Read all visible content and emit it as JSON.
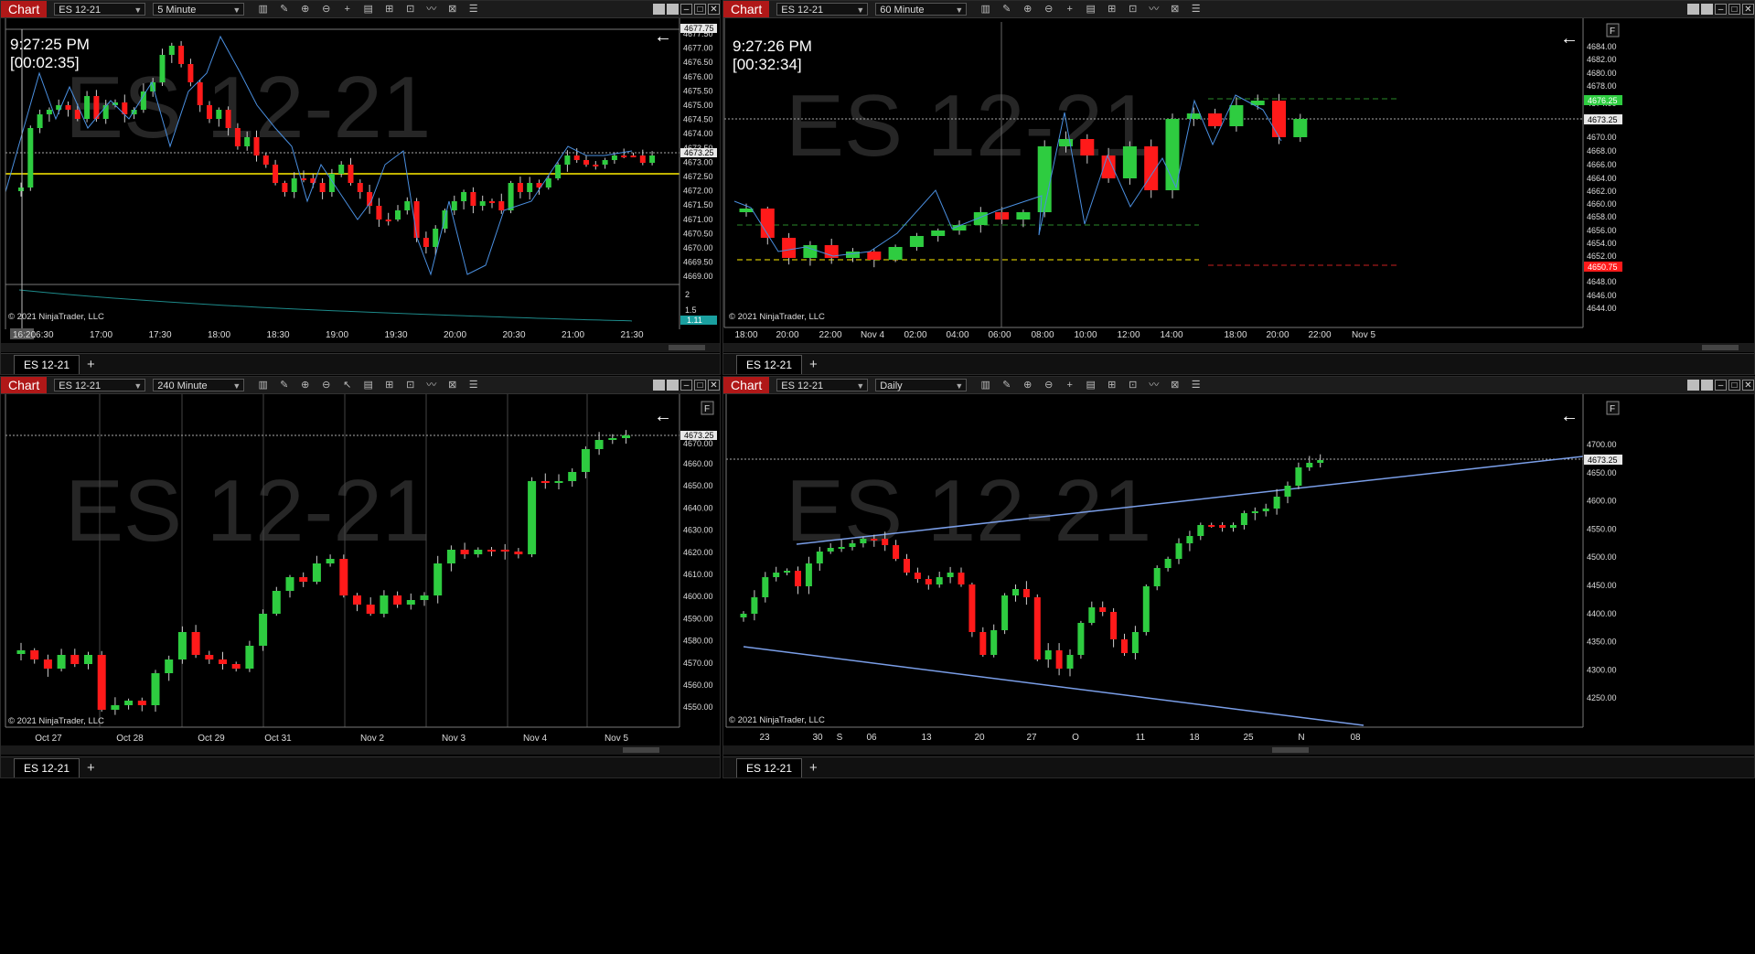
{
  "chart_label": "Chart",
  "copyright": "© 2021 NinjaTrader, LLC",
  "tab_label": "ES 12-21",
  "tab_add": "+",
  "back_arrow": "←",
  "f_label": "F",
  "colors": {
    "up": "#2ecc40",
    "down": "#ff1a1a",
    "label_red": "#b01818",
    "yellow": "#ffee00",
    "zigzag": "#4a8fe0",
    "price_tag": "#e8e8e8"
  },
  "icons": [
    "bars-icon",
    "pencil-icon",
    "zoom-in-icon",
    "zoom-out-icon",
    "crosshair-icon",
    "data-box-icon",
    "properties-icon",
    "strategy-icon",
    "indicator-icon",
    "templates-icon",
    "list-icon"
  ],
  "panels": [
    {
      "instrument": "ES 12-21",
      "interval": "5 Minute",
      "watermark": "ES 12-21",
      "clock": "9:27:25 PM",
      "countdown": "[00:02:35]",
      "price_labels": [
        "4677.50",
        "4677.00",
        "4676.50",
        "4676.00",
        "4675.50",
        "4675.00",
        "4674.50",
        "4674.00",
        "4673.50",
        "4673.00",
        "4672.50",
        "4672.00",
        "4671.50",
        "4671.00",
        "4670.50",
        "4670.00",
        "4669.50",
        "4669.00"
      ],
      "last_price": "4673.25",
      "top_price": "4677.75",
      "yellow_level": "4672.50",
      "indicator_labels": [
        "2",
        "1.5"
      ],
      "indicator_value": "1.11",
      "time_labels": [
        "16:30",
        "17:00",
        "17:30",
        "18:00",
        "18:30",
        "19:00",
        "19:30",
        "20:00",
        "20:30",
        "21:00",
        "21:30"
      ],
      "time_cursor": "16:20"
    },
    {
      "instrument": "ES 12-21",
      "interval": "60 Minute",
      "watermark": "ES 12-21",
      "clock": "9:27:26 PM",
      "countdown": "[00:32:34]",
      "price_labels": [
        "4684.00",
        "4682.00",
        "4680.00",
        "4678.00",
        "4674.00",
        "4670.00",
        "4668.00",
        "4666.00",
        "4664.00",
        "4662.00",
        "4660.00",
        "4658.00",
        "4656.00",
        "4654.00",
        "4652.00",
        "4648.00",
        "4646.00",
        "4644.00"
      ],
      "last_price": "4673.25",
      "green_tag": "4676.25",
      "red_tag": "4650.75",
      "time_labels": [
        "18:00",
        "20:00",
        "22:00",
        "Nov 4",
        "02:00",
        "04:00",
        "06:00",
        "08:00",
        "10:00",
        "12:00",
        "14:00",
        "18:00",
        "20:00",
        "22:00",
        "Nov 5"
      ]
    },
    {
      "instrument": "ES 12-21",
      "interval": "240 Minute",
      "watermark": "ES 12-21",
      "price_labels": [
        "4660.00",
        "4650.00",
        "4640.00",
        "4630.00",
        "4620.00",
        "4610.00",
        "4600.00",
        "4590.00",
        "4580.00",
        "4570.00",
        "4560.00",
        "4550.00"
      ],
      "last_price": "4673.25",
      "top_label": "4670.00",
      "time_labels": [
        "Oct 27",
        "Oct 28",
        "Oct 29",
        "Oct 31",
        "Nov 2",
        "Nov 3",
        "Nov 4",
        "Nov 5"
      ]
    },
    {
      "instrument": "ES 12-21",
      "interval": "Daily",
      "watermark": "ES 12-21",
      "price_labels": [
        "4700.00",
        "4650.00",
        "4600.00",
        "4550.00",
        "4500.00",
        "4450.00",
        "4400.00",
        "4350.00",
        "4300.00",
        "4250.00"
      ],
      "last_price": "4673.25",
      "time_labels": [
        "23",
        "30",
        "S",
        "06",
        "13",
        "20",
        "27",
        "O",
        "11",
        "18",
        "25",
        "N",
        "08"
      ]
    }
  ]
}
